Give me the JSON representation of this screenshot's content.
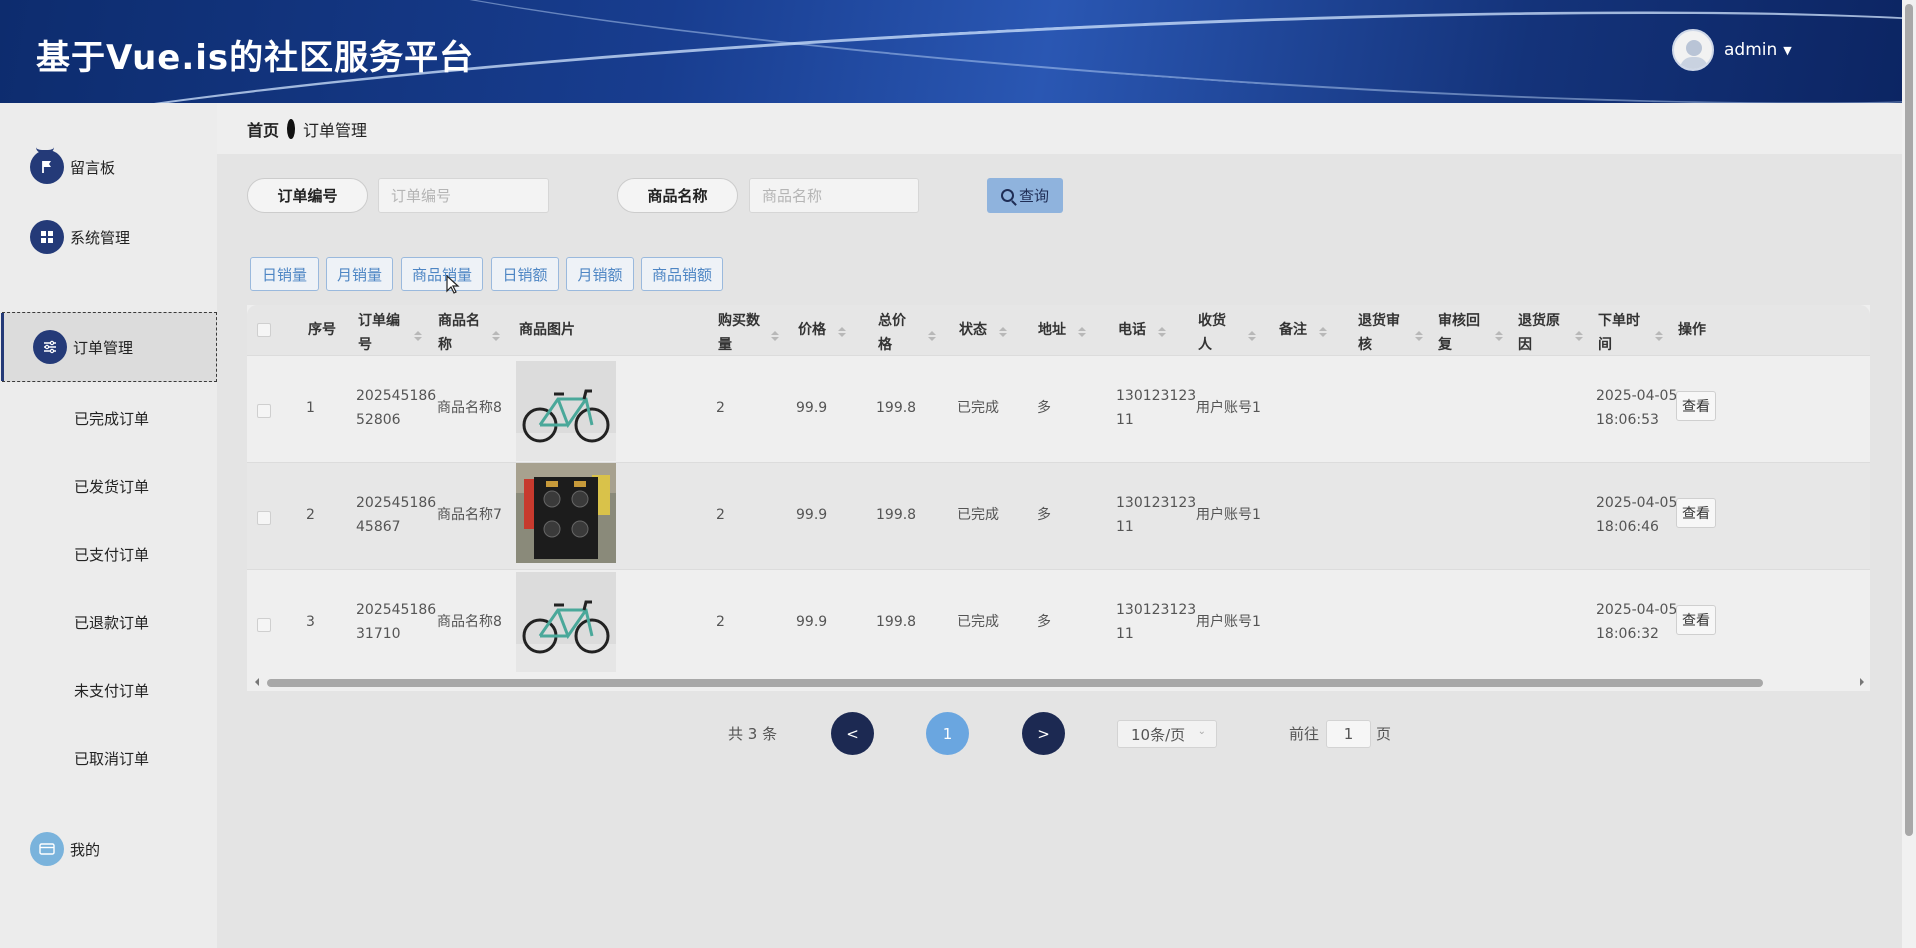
{
  "header": {
    "title": "基于Vue.is的社区服务平台",
    "username": "admin"
  },
  "sidebar": {
    "items": [
      {
        "label": "留言板",
        "icon": "flag-icon"
      },
      {
        "label": "系统管理",
        "icon": "grid-icon"
      },
      {
        "label": "订单管理",
        "icon": "sliders-icon"
      }
    ],
    "sub_items": [
      "已完成订单",
      "已发货订单",
      "已支付订单",
      "已退款订单",
      "未支付订单",
      "已取消订单"
    ],
    "bottom": {
      "label": "我的",
      "icon": "card-icon"
    }
  },
  "breadcrumb": {
    "home": "首页",
    "current": "订单管理"
  },
  "search": {
    "order_no_label": "订单编号",
    "order_no_placeholder": "订单编号",
    "product_label": "商品名称",
    "product_placeholder": "商品名称",
    "query_label": "查询"
  },
  "stat_buttons": [
    "日销量",
    "月销量",
    "商品销量",
    "日销额",
    "月销额",
    "商品销额"
  ],
  "table": {
    "headers": {
      "index": "序号",
      "order_no": [
        "订单编",
        "号"
      ],
      "product_name": [
        "商品名",
        "称"
      ],
      "image": "商品图片",
      "qty": [
        "购买数",
        "量"
      ],
      "price": "价格",
      "total": [
        "总价",
        "格"
      ],
      "status": "状态",
      "address": "地址",
      "phone": "电话",
      "receiver": [
        "收货",
        "人"
      ],
      "remark": "备注",
      "refund_review": [
        "退货审",
        "核"
      ],
      "review_reply": [
        "审核回",
        "复"
      ],
      "refund_reason": [
        "退货原",
        "因"
      ],
      "order_time": [
        "下单时",
        "间"
      ],
      "actions": "操作"
    },
    "rows": [
      {
        "index": "1",
        "order_no": [
          "202545186",
          "52806"
        ],
        "product_name": "商品名称8",
        "image": "bicycle",
        "qty": "2",
        "price": "99.9",
        "total": "199.8",
        "status": "已完成",
        "address": "多",
        "phone": [
          "130123123",
          "11"
        ],
        "receiver": "用户账号1",
        "date": "2025-04-05",
        "time": "18:06:53",
        "action": "查看"
      },
      {
        "index": "2",
        "order_no": [
          "202545186",
          "45867"
        ],
        "product_name": "商品名称7",
        "image": "speakers",
        "qty": "2",
        "price": "99.9",
        "total": "199.8",
        "status": "已完成",
        "address": "多",
        "phone": [
          "130123123",
          "11"
        ],
        "receiver": "用户账号1",
        "date": "2025-04-05",
        "time": "18:06:46",
        "action": "查看"
      },
      {
        "index": "3",
        "order_no": [
          "202545186",
          "31710"
        ],
        "product_name": "商品名称8",
        "image": "bicycle",
        "qty": "2",
        "price": "99.9",
        "total": "199.8",
        "status": "已完成",
        "address": "多",
        "phone": [
          "130123123",
          "11"
        ],
        "receiver": "用户账号1",
        "date": "2025-04-05",
        "time": "18:06:32",
        "action": "查看"
      }
    ]
  },
  "pagination": {
    "total": "共 3 条",
    "prev": "<",
    "current": "1",
    "next": ">",
    "page_size": "10条/页",
    "goto_label": "前往",
    "goto_value": "1",
    "page_suffix": "页"
  },
  "colors": {
    "header_blue": "#183d8f",
    "nav_dark": "#243a78",
    "accent": "#6aa6e0"
  }
}
